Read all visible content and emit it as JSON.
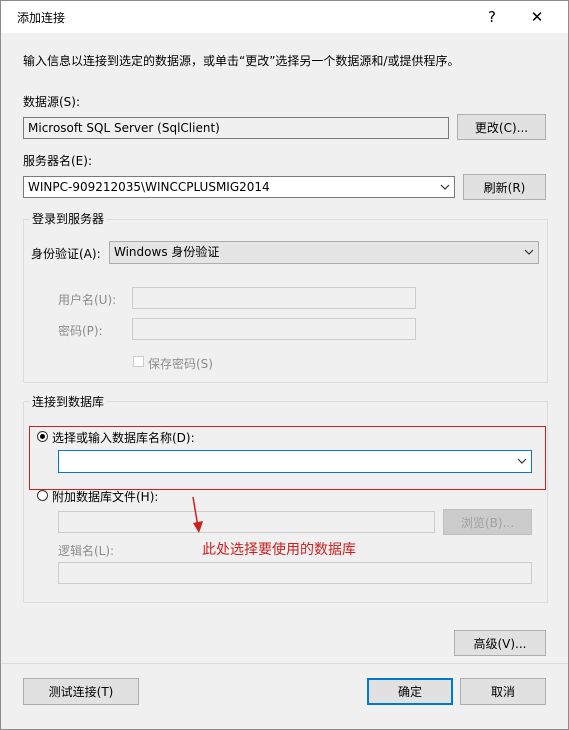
{
  "window": {
    "title": "添加连接",
    "help_glyph": "?",
    "close_glyph": "✕"
  },
  "description": "输入信息以连接到选定的数据源，或单击“更改”选择另一个数据源和/或提供程序。",
  "datasource": {
    "label": "数据源(S):",
    "value": "Microsoft SQL Server (SqlClient)",
    "change_button": "更改(C)..."
  },
  "server": {
    "label": "服务器名(E):",
    "value": "WINPC-909212035\\WINCCPLUSMIG2014",
    "refresh_button": "刷新(R)"
  },
  "login": {
    "group_title": "登录到服务器",
    "auth_label": "身份验证(A):",
    "auth_value": "Windows 身份验证",
    "username_label": "用户名(U):",
    "password_label": "密码(P):",
    "save_password_label": "保存密码(S)"
  },
  "database": {
    "group_title": "连接到数据库",
    "select_radio_label": "选择或输入数据库名称(D):",
    "select_value": "",
    "attach_radio_label": "附加数据库文件(H):",
    "browse_button": "浏览(B)...",
    "logical_name_label": "逻辑名(L):"
  },
  "annotation": {
    "text": "此处选择要使用的数据库",
    "color": "#cc1f1f"
  },
  "buttons": {
    "advanced": "高级(V)...",
    "test": "测试连接(T)",
    "ok": "确定",
    "cancel": "取消"
  }
}
